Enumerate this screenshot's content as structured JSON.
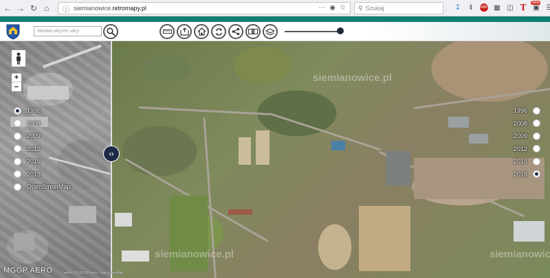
{
  "browser": {
    "url_prefix": "siemianowice.",
    "url_domain": "retromapy.pl",
    "search_placeholder": "Szukaj",
    "new_badge": "New"
  },
  "header": {
    "street_search_placeholder": "Nazwa ulicy/nr ulicy"
  },
  "map": {
    "left_years": [
      {
        "label": "1996",
        "checked": true
      },
      {
        "label": "2008",
        "checked": false
      },
      {
        "label": "2009",
        "checked": false
      },
      {
        "label": "2012",
        "checked": false
      },
      {
        "label": "2015",
        "checked": false
      },
      {
        "label": "2018",
        "checked": false
      },
      {
        "label": "OpenStreetMap",
        "checked": false
      }
    ],
    "right_years": [
      {
        "label": "1996",
        "checked": false
      },
      {
        "label": "2008",
        "checked": false
      },
      {
        "label": "2009",
        "checked": false
      },
      {
        "label": "2012",
        "checked": false
      },
      {
        "label": "2015",
        "checked": false
      },
      {
        "label": "2018",
        "checked": true
      }
    ],
    "watermark": "siemianowice.pl",
    "provider": "MGGP AERO",
    "zoom_in": "+",
    "zoom_out": "−",
    "credits": "Leaflet | © MGGP Aero, OpenStreetMap"
  },
  "colors": {
    "accent": "#0c7f71",
    "handle": "#1e2b46"
  }
}
